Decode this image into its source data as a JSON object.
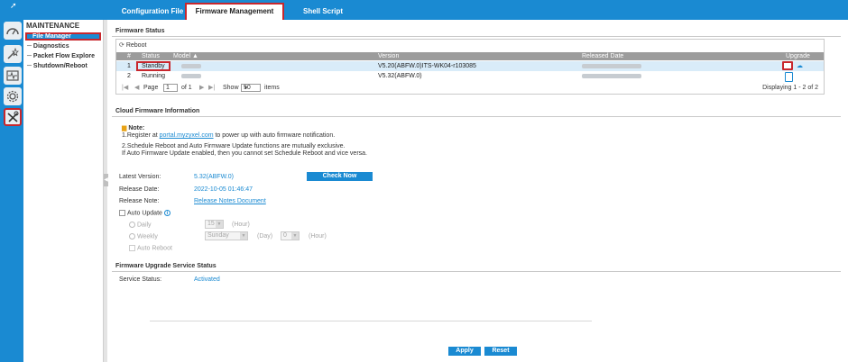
{
  "tabs": [
    {
      "label": "Configuration File"
    },
    {
      "label": "Firmware Management"
    },
    {
      "label": "Shell Script"
    }
  ],
  "nav": {
    "title": "MAINTENANCE",
    "items": [
      {
        "label": "File Manager"
      },
      {
        "label": "Diagnostics"
      },
      {
        "label": "Packet Flow Explore"
      },
      {
        "label": "Shutdown/Reboot"
      }
    ]
  },
  "firmware_status": {
    "section_title": "Firmware Status",
    "reboot_label": "Reboot",
    "columns": {
      "index": "#",
      "status": "Status",
      "model": "Model",
      "version": "Version",
      "released_date": "Released Date",
      "upgrade": "Upgrade"
    },
    "rows": [
      {
        "index": "1",
        "status": "Standby",
        "version": "V5.20(ABFW.0)ITS-WK04-r103085"
      },
      {
        "index": "2",
        "status": "Running",
        "version": "V5.32(ABFW.0)"
      }
    ],
    "pager": {
      "page_label": "Page",
      "page_value": "1",
      "of_label": "of 1",
      "show_label": "Show",
      "show_value": "50",
      "items_label": "items",
      "displaying": "Displaying 1 - 2 of 2"
    }
  },
  "cloud": {
    "section_title": "Cloud Firmware Information",
    "note_title": "Note:",
    "note1_prefix": "1.Register at ",
    "note1_link": "portal.myzyxel.com",
    "note1_suffix": " to power up with auto firmware notification.",
    "note2": "2.Schedule Reboot and Auto Firmware Update functions are mutually exclusive.",
    "note3": "If Auto Firmware Update enabled, then you cannot set Schedule Reboot and vice versa.",
    "latest_label": "Latest Version:",
    "latest_value": "5.32(ABFW.0)",
    "check_now": "Check Now",
    "release_date_label": "Release Date:",
    "release_date_value": "2022-10-05 01:46:47",
    "release_note_label": "Release Note:",
    "release_note_value": "Release Notes Document",
    "auto_update_label": "Auto Update",
    "daily_label": "Daily",
    "weekly_label": "Weekly",
    "daily_hour": "15",
    "hour_label": "(Hour)",
    "weekly_day": "Sunday",
    "day_label": "(Day)",
    "weekly_hour": "0",
    "auto_reboot_label": "Auto Reboot"
  },
  "service": {
    "section_title": "Firmware Upgrade Service Status",
    "status_label": "Service Status:",
    "status_value": "Activated"
  },
  "buttons": {
    "apply": "Apply",
    "reset": "Reset"
  },
  "icons": {
    "left_bar": [
      "dashboard-icon",
      "wand-icon",
      "monitor-icon",
      "gear-icon",
      "maintenance-tools-icon"
    ],
    "upgrade": "upload-icon",
    "cloud_upgrade": "cloud-upload-icon",
    "note": "note-icon",
    "info": "info-icon"
  },
  "colors": {
    "accent": "#1a8ad2",
    "highlight_border": "#c8272d",
    "selected_row": "#d9ecf9"
  }
}
